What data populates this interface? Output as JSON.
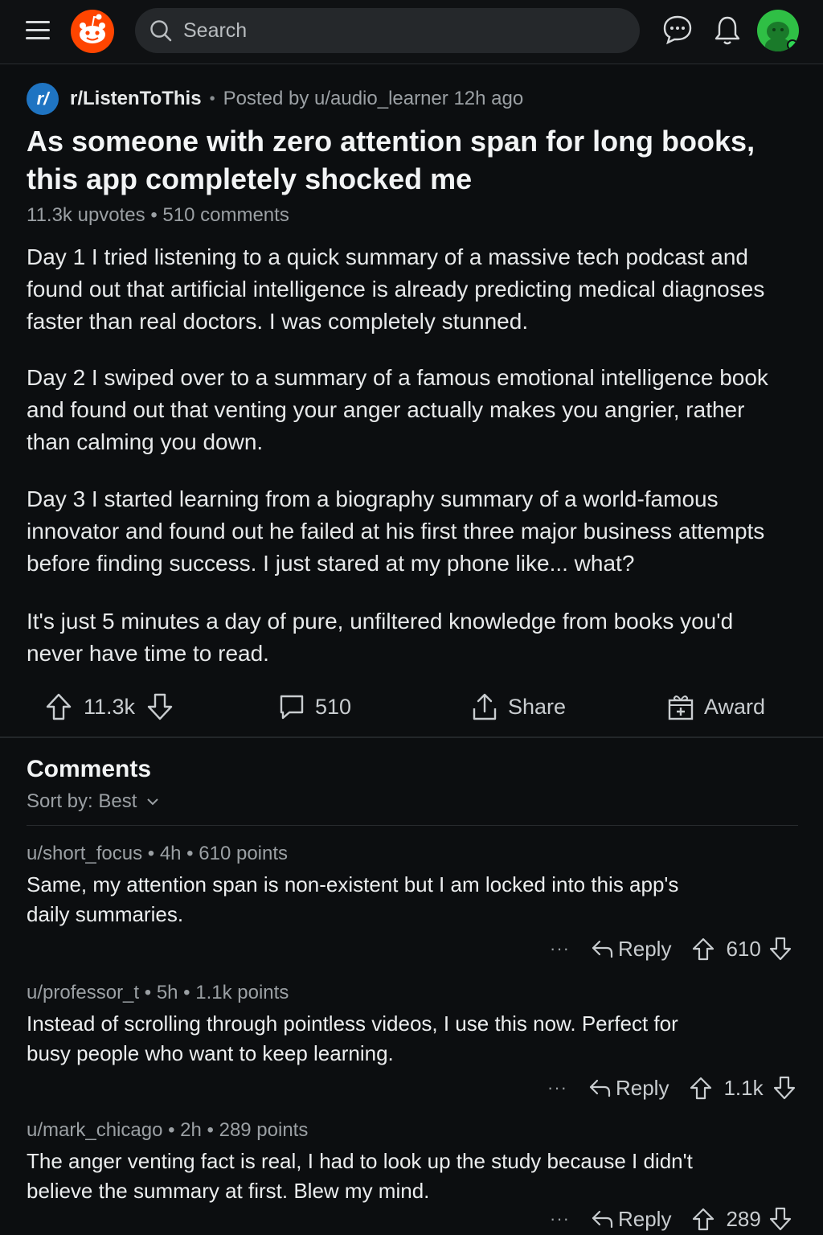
{
  "topbar": {
    "search_placeholder": "Search",
    "icons": [
      "menu-icon",
      "reddit-logo",
      "search-icon",
      "chat-icon",
      "bell-icon",
      "avatar"
    ]
  },
  "post": {
    "subreddit_icon": "r/",
    "subreddit": "r/ListenToThis",
    "posted_by": "Posted by u/audio_learner 12h ago",
    "title": "As someone with zero attention span for long books, this app completely shocked me",
    "upvotes": "11.3k upvotes",
    "comments_count": "510 comments",
    "paragraphs": [
      "Day 1 I tried listening to a quick summary of a massive tech podcast and found out that artificial intelligence is already predicting medical diagnoses faster than real doctors. I was completely stunned.",
      "Day 2 I swiped over to a summary of a famous emotional intelligence book and found out that venting your anger actually makes you angrier, rather than calming you down.",
      "Day 3 I started learning from a biography summary of a world-famous innovator and found out he failed at his first three major business attempts before finding success. I just stared at my phone like... what?",
      "It's just 5 minutes a day of pure, unfiltered knowledge from books you'd never have time to read."
    ],
    "actions": {
      "score": "11.3k",
      "comments": "510",
      "share": "Share",
      "award": "Award"
    }
  },
  "comments_section": {
    "heading": "Comments",
    "sort_label": "Sort by: Best",
    "comments": [
      {
        "meta": "u/short_focus • 4h • 610 points",
        "body": "Same, my attention span is non-existent but I am locked into this app's daily summaries.",
        "more": "···",
        "reply": "Reply",
        "score": "610"
      },
      {
        "meta": "u/professor_t • 5h • 1.1k points",
        "body": "Instead of scrolling through pointless videos, I use this now. Perfect for busy people who want to keep learning.",
        "more": "···",
        "reply": "Reply",
        "score": "1.1k"
      },
      {
        "meta": "u/mark_chicago • 2h • 289 points",
        "body": "The anger venting fact is real, I had to look up the study because I didn't believe the summary at first. Blew my mind.",
        "more": "···",
        "reply": "Reply",
        "score": "289"
      }
    ]
  },
  "colors": {
    "background": "#0c0e10",
    "brand": "#ff4500",
    "subreddit_icon": "#1f74c2",
    "avatar": "#2fbf45"
  }
}
